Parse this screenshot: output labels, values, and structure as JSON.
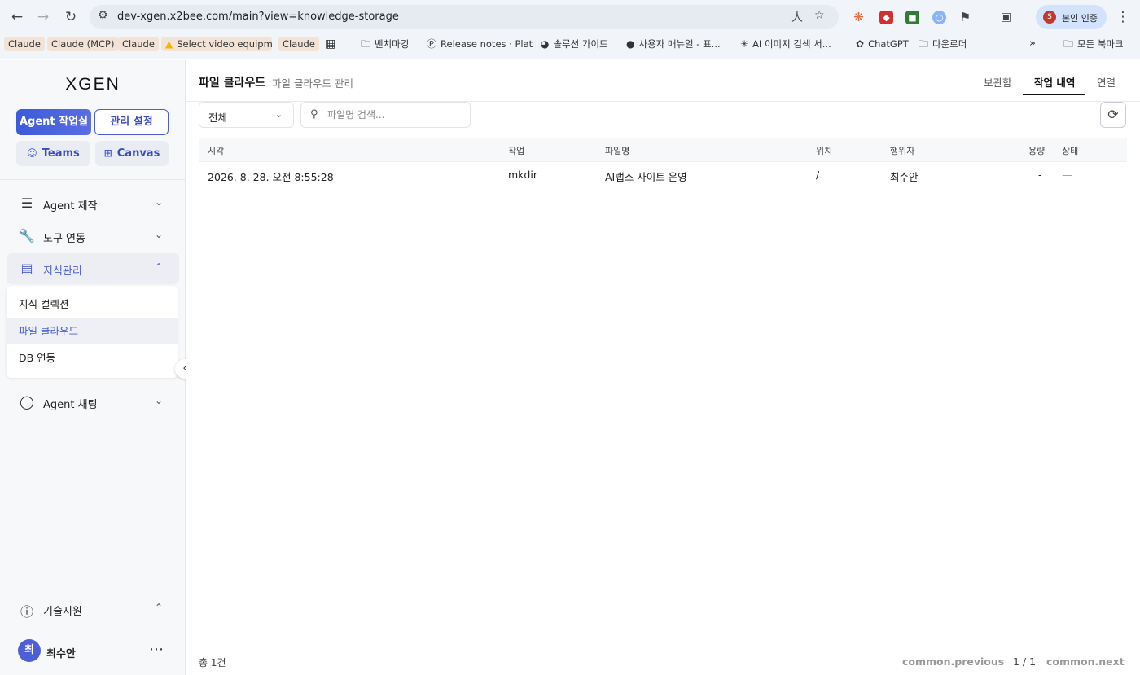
{
  "browser": {
    "url": "dev-xgen.x2bee.com/main?view=knowledge-storage",
    "profile_label": "본인 인증",
    "profile_initial": "S",
    "bookmarks": [
      {
        "label": "Claude"
      },
      {
        "label": "Claude (MCP)"
      },
      {
        "label": "Claude"
      },
      {
        "label": "Select video equipm..."
      },
      {
        "label": "Claude"
      },
      {
        "label": "벤치마킹"
      },
      {
        "label": "Release notes · Plat..."
      },
      {
        "label": "솔루션 가이드"
      },
      {
        "label": "사용자 매뉴얼 - 표..."
      },
      {
        "label": "AI 이미지 검색 서..."
      },
      {
        "label": "ChatGPT"
      },
      {
        "label": "다운로더"
      },
      {
        "label": "모든 북마크"
      }
    ]
  },
  "sidebar": {
    "logo": "XGEN",
    "primary_buttons": {
      "agent": "Agent 작업실",
      "admin": "관리 설정"
    },
    "secondary_buttons": {
      "teams": "Teams",
      "canvas": "Canvas"
    },
    "menu": [
      {
        "label": "Agent 제작",
        "icon": "layers-icon"
      },
      {
        "label": "도구 연동",
        "icon": "wrench-icon"
      },
      {
        "label": "지식관리",
        "icon": "book-icon"
      },
      {
        "label": "Agent 채팅",
        "icon": "chat-icon"
      }
    ],
    "submenu": [
      "지식 컬렉션",
      "파일 클라우드",
      "DB 연동"
    ],
    "support": "기술지원",
    "user": {
      "initial": "최",
      "name": "최수안"
    }
  },
  "header": {
    "title": "파일 클라우드",
    "subtitle": "파일 클라우드 관리",
    "tabs": [
      "보관함",
      "작업 내역",
      "연결"
    ],
    "active_tab": "작업 내역"
  },
  "filters": {
    "select_value": "전체",
    "search_placeholder": "파일명 검색..."
  },
  "table": {
    "columns": [
      "시각",
      "작업",
      "파일명",
      "위치",
      "행위자",
      "용량",
      "상태"
    ],
    "rows": [
      {
        "time": "2026. 8. 28. 오전 8:55:28",
        "action": "mkdir",
        "filename": "AI랩스 사이트 운영",
        "location": "/",
        "actor": "최수안",
        "size": "-",
        "status": "—"
      }
    ]
  },
  "footer": {
    "count": "총 1건",
    "prev": "common.previous",
    "page": "1 / 1",
    "next": "common.next"
  }
}
